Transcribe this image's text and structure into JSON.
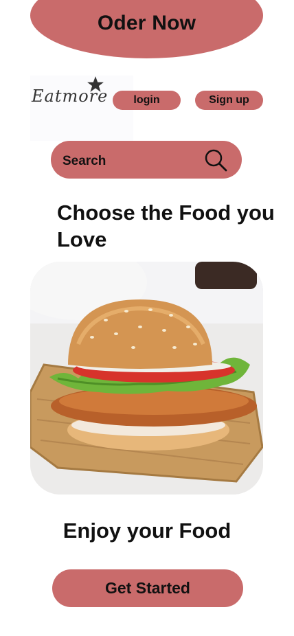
{
  "header": {
    "order_label": "Oder Now"
  },
  "brand": {
    "name": "Eatmore",
    "icon": "star-icon"
  },
  "auth": {
    "login_label": "login",
    "signup_label": "Sign up"
  },
  "search": {
    "label": "Search",
    "icon": "search-icon"
  },
  "hero": {
    "headline": "Choose the Food you Love",
    "image": "burger-image"
  },
  "footer": {
    "subheadline": "Enjoy your Food",
    "cta_label": "Get Started"
  },
  "colors": {
    "accent": "#c96b6b",
    "text": "#111111",
    "background": "#ffffff"
  }
}
